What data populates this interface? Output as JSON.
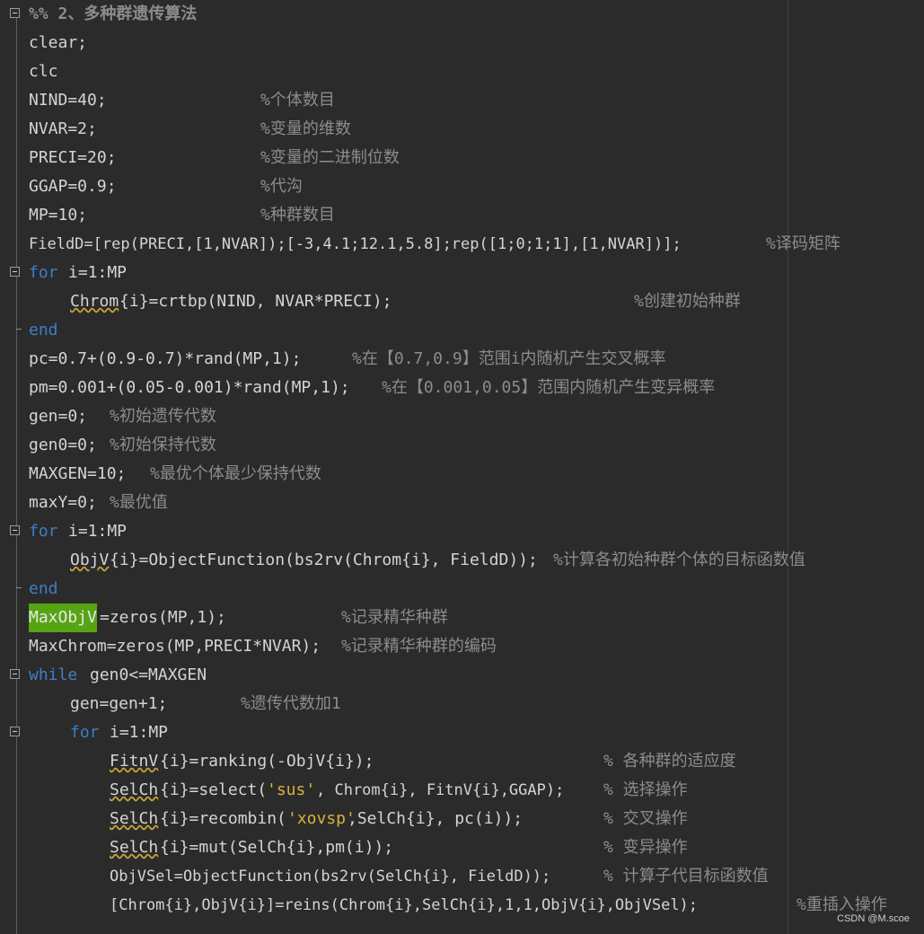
{
  "editor": {
    "lines": [
      {
        "section": "%% 2、多种群遗传算法"
      },
      {
        "code": "clear;"
      },
      {
        "code": "clc"
      },
      {
        "code": "NIND=40;",
        "comment": "%个体数目"
      },
      {
        "code": "NVAR=2;",
        "comment": "%变量的维数"
      },
      {
        "code": "PRECI=20;",
        "comment": "%变量的二进制位数"
      },
      {
        "code": "GGAP=0.9;",
        "comment": "%代沟"
      },
      {
        "code": "MP=10;",
        "comment": "%种群数目"
      },
      {
        "code": "FieldD=[rep(PRECI,[1,NVAR]);[-3,4.1;12.1,5.8];rep([1;0;1;1],[1,NVAR])];",
        "comment": "%译码矩阵"
      },
      {
        "kw": "for",
        "code": "i=1:MP"
      },
      {
        "warn": "Chrom",
        "code": "{i}=crtbp(NIND, NVAR*PRECI);",
        "comment": "%创建初始种群"
      },
      {
        "kw": "end"
      },
      {
        "code": "pc=0.7+(0.9-0.7)*rand(MP,1);",
        "comment": "%在【0.7,0.9】范围i内随机产生交叉概率"
      },
      {
        "code": "pm=0.001+(0.05-0.001)*rand(MP,1);",
        "comment": "%在【0.001,0.05】范围内随机产生变异概率"
      },
      {
        "code": "gen=0;",
        "comment": "%初始遗传代数"
      },
      {
        "code": "gen0=0;",
        "comment": "%初始保持代数"
      },
      {
        "code": "MAXGEN=10;",
        "comment": "%最优个体最少保持代数"
      },
      {
        "code": "maxY=0;",
        "comment": "%最优值"
      },
      {
        "kw": "for",
        "code": "i=1:MP"
      },
      {
        "warn": "ObjV",
        "code": "{i}=ObjectFunction(bs2rv(Chrom{i}, FieldD));",
        "comment": "%计算各初始种群个体的目标函数值"
      },
      {
        "kw": "end"
      },
      {
        "hl": "MaxObjV",
        "code": "=zeros(MP,1);",
        "comment": "%记录精华种群"
      },
      {
        "code": "MaxChrom=zeros(MP,PRECI*NVAR);",
        "comment": "%记录精华种群的编码"
      },
      {
        "kw": "while",
        "code": "gen0<=MAXGEN"
      },
      {
        "code": "gen=gen+1;",
        "comment": "%遗传代数加1"
      },
      {
        "kw": "for",
        "code": "i=1:MP"
      },
      {
        "warn": "FitnV",
        "code": "{i}=ranking(-ObjV{i});",
        "comment": "% 各种群的适应度"
      },
      {
        "warn": "SelCh",
        "code": "{i}=select(",
        "str": "'sus'",
        "code2": ", Chrom{i}, FitnV{i},GGAP);",
        "comment": "% 选择操作"
      },
      {
        "warn": "SelCh",
        "code": "{i}=recombin(",
        "str": "'xovsp'",
        "code2": ",SelCh{i}, pc(i));",
        "comment": "% 交叉操作"
      },
      {
        "warn": "SelCh",
        "code": "{i}=mut(SelCh{i},pm(i));",
        "comment": "% 变异操作"
      },
      {
        "code": "ObjVSel=ObjectFunction(bs2rv(SelCh{i}, FieldD));",
        "comment": "% 计算子代目标函数值"
      },
      {
        "code": "[Chrom{i},ObjV{i}]=reins(Chrom{i},SelCh{i},1,1,ObjV{i},ObjVSel);",
        "comment": "%重插入操作"
      }
    ]
  },
  "watermark": "CSDN @M.scoe"
}
